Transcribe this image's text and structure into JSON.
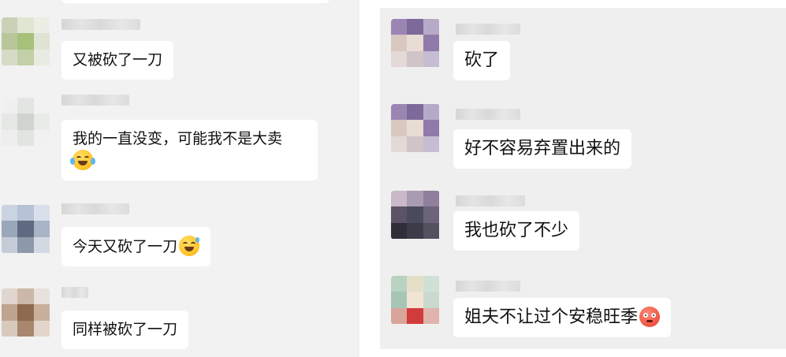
{
  "left_chat": {
    "messages": [
      {
        "text": "又被砍了一刀",
        "emoji": ""
      },
      {
        "text": "我的一直没变，可能我不是大卖",
        "emoji": "face-with-tears-of-joy"
      },
      {
        "text": "今天又砍了一刀",
        "emoji": "grinning-face-with-sweat"
      },
      {
        "text": "同样被砍了一刀",
        "emoji": ""
      }
    ]
  },
  "right_chat": {
    "messages": [
      {
        "text": "砍了",
        "emoji": ""
      },
      {
        "text": "好不容易弃置出来的",
        "emoji": ""
      },
      {
        "text": "我也砍了不少",
        "emoji": ""
      },
      {
        "text": "姐夫不让过个安稳旺季",
        "emoji": "flushed-face"
      }
    ]
  },
  "colors": {
    "left_background": "#f2f2f2",
    "right_background": "#efefef",
    "bubble": "#ffffff",
    "text": "#111111"
  }
}
